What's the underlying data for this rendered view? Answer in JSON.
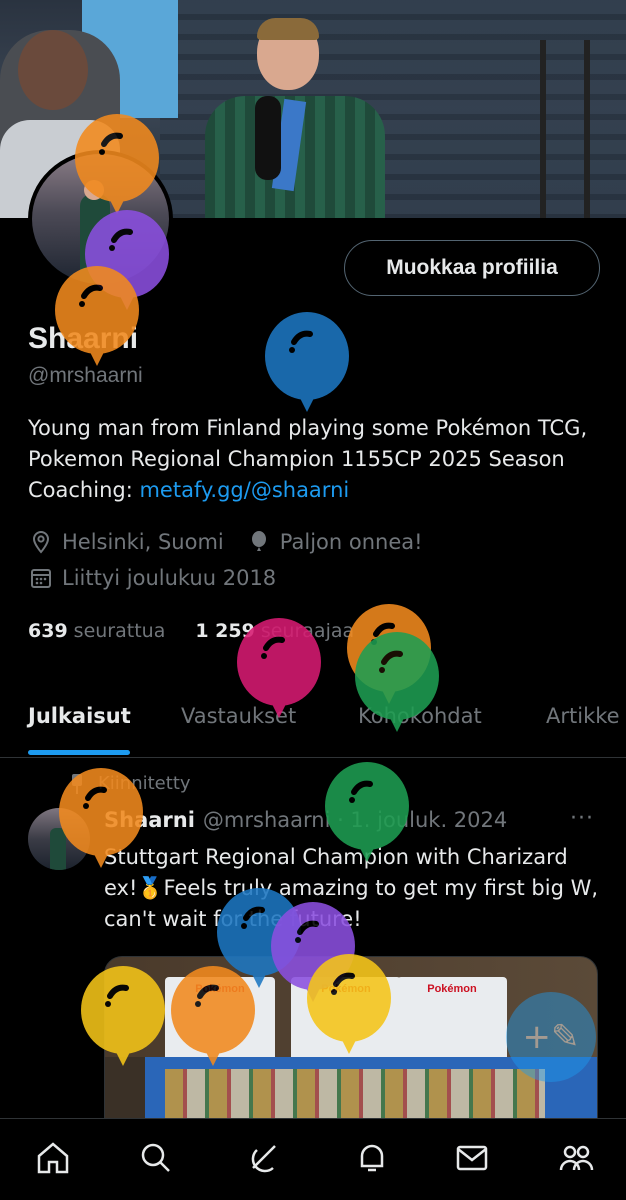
{
  "profile": {
    "edit_button": "Muokkaa profiilia",
    "name": "Shaarni",
    "handle": "@mrshaarni",
    "bio_text": "Young man from Finland playing some Pokémon TCG, Pokemon Regional Champion 1155CP 2025 Season Coaching: ",
    "bio_link": "metafy.gg/@shaarni",
    "location": "Helsinki, Suomi",
    "birthday": "Paljon onnea!",
    "joined": "Liittyi joulukuu 2018",
    "following_count": "639",
    "following_label": "seurattua",
    "followers_count": "1 259",
    "followers_label": "seuraajaa"
  },
  "tabs": [
    {
      "label": "Julkaisut",
      "active": true
    },
    {
      "label": "Vastaukset",
      "active": false
    },
    {
      "label": "Kohokohdat",
      "active": false
    },
    {
      "label": "Artikke",
      "active": false
    }
  ],
  "post": {
    "pinned_label": "Kiinnitetty",
    "author_name": "Shaarni",
    "author_meta": "@mrshaarni · 1. jouluk. 2024",
    "more": "···",
    "text": "Stuttgart Regional Champion with Charizard ex!🥇Feels truly amazing to get my first big W, can't wait for the future!",
    "image_box_label": "Pokémon"
  },
  "fab": {
    "icon": "compose-icon",
    "symbol": "+✎"
  },
  "nav": [
    "home-icon",
    "search-icon",
    "grok-icon",
    "notifications-icon",
    "messages-icon",
    "communities-icon"
  ],
  "balloons": [
    {
      "color": "#f28a1e"
    },
    {
      "color": "#8b4fe0"
    },
    {
      "color": "#f28a1e"
    },
    {
      "color": "#1d77c2"
    },
    {
      "color": "#d81b72"
    },
    {
      "color": "#f28a1e"
    },
    {
      "color": "#1e9e52"
    },
    {
      "color": "#f28a1e"
    },
    {
      "color": "#1e9e52"
    },
    {
      "color": "#1d77c2"
    },
    {
      "color": "#8b4fe0"
    },
    {
      "color": "#f5c518"
    },
    {
      "color": "#f28a1e"
    },
    {
      "color": "#f5c518"
    }
  ]
}
